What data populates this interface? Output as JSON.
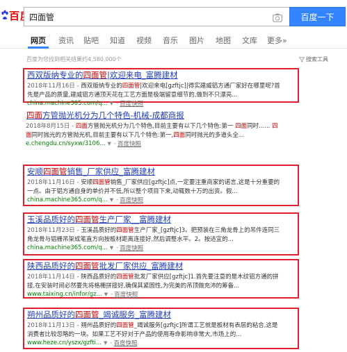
{
  "logo": {
    "text": "百度"
  },
  "search": {
    "query": "四面管",
    "button": "百度一下"
  },
  "tabs": [
    {
      "label": "网页",
      "active": true
    },
    {
      "label": "资讯"
    },
    {
      "label": "贴吧"
    },
    {
      "label": "知道"
    },
    {
      "label": "视频"
    },
    {
      "label": "音乐"
    },
    {
      "label": "图片"
    },
    {
      "label": "地图"
    },
    {
      "label": "文库"
    },
    {
      "label": "更多»"
    }
  ],
  "stats": "百度为您找到相关结果约4,580,000个",
  "tools": "搜索工具",
  "results": [
    {
      "title_pre": "西双版纳专业的",
      "title_hl": "四面管",
      "title_post": "|欢迎来电_富腾建材",
      "date": "2018年11月16日 - ",
      "abs1_pre": "西双版纳专业的",
      "abs1_hl": "四面管",
      "abs1_post": "|欢迎来电[gzftjc]|得实建威铝方通厂家好在哪里呢?首",
      "abs2": "先是产品的质量,建威铝方通顶天花在工艺方面是极端留意细节的,做到不只漂亮...",
      "url": "china.machine365.com/q...",
      "snapshot": "百度快照"
    },
    {
      "title_hl": "四面",
      "title_post": "方管抛光机分为几个特色-机械-成都商报",
      "date": "2018年8月15日 - ",
      "abs1_pre": "",
      "abs1_hl": "四面",
      "abs1_post": "方管抛光机分为几个特色,目前主要有以下几个特色:第一 ",
      "abs1_hl2": "四面",
      "abs1_post2": "同时...... ",
      "abs1_hl3": "四",
      "abs2_hl": "面",
      "abs2": "同时抛光的方管抛光机,目前主要有以下几个特色:第一,",
      "abs2_hl2": "四面",
      "abs2_post": "同时抛光的多道头全...",
      "url": "e.chengdu.cn/syxw/3106...",
      "snapshot": "百度快照"
    },
    {
      "title_pre": "安顺",
      "title_hl": "四面管",
      "title_post": "销售_厂家供应_富腾建材",
      "date": "2018年11月16日 - ",
      "abs1_pre": "安顺",
      "abs1_hl": "四面管",
      "abs1_post": "销售_厂家供应[gzftjc]点,一定要注重商家的诺言,这是十分重要的",
      "abs2": "一点。由于铝方通自身的单价并不低,所以整个项目下来,动辄数十万的出资。假...",
      "url": "china.machine365.com/q...",
      "snapshot": "百度快照"
    },
    {
      "title_pre": "玉溪品质好的",
      "title_hl": "四面管",
      "title_post": "生产厂家__富腾建材",
      "date": "2018年11月23日 - ",
      "abs1_pre": "玉溪品质好的",
      "abs1_hl": "四面管",
      "abs1_post": "生产厂家_[gzftjc]3。把预装在三角龙骨上的吊件连同三",
      "abs2": "角龙骨与铝栅吊架成笔直方向按板材距离连接好,然后调整水平。2。按适宜的...",
      "url": "china.machine365.com/q...",
      "snapshot": "百度快照"
    },
    {
      "title_pre": "陕西品质好的",
      "title_hl": "四面管",
      "title_post": "批发厂家供应_富腾建材",
      "date": "2018年11月14日 - ",
      "abs1_pre": "陕西品质好的",
      "abs1_hl": "四面管",
      "abs1_post": "批发厂家供应[gzftjc]1.首先要注意的是木纹铝方通的拼",
      "abs2": "接,在安装时间必然要先将格栅拼接好,确保其紧固性,为完美的吊顶做充沛的筹备...",
      "url": "www.taixing.cn/infor/gz...",
      "snapshot": "百度快照"
    },
    {
      "title_pre": "朔州品质好的",
      "title_hl": "四面管",
      "title_post": "_竭诚服务_富腾建材",
      "date": "2018年11月13日 - ",
      "abs1_pre": "朔州品质好的",
      "abs1_hl": "四面管",
      "abs1_post": "_竭诚服务[gzftjc]所谓工艺就是板材有表层的粘合,这是",
      "abs2": "消费者比较忽略的一块。如果工艺不好对于产品的使用寿命影响非常大,市场上的...",
      "url": "www.heze.cn/yszx/gzfti...",
      "snapshot": "百度快照"
    }
  ],
  "colors": {
    "link": "#2440b3",
    "highlight": "#cc0000",
    "url": "#008000",
    "annotation_box": "#e21d2c",
    "search_button": "#3385ff",
    "logo": "#e10601"
  }
}
